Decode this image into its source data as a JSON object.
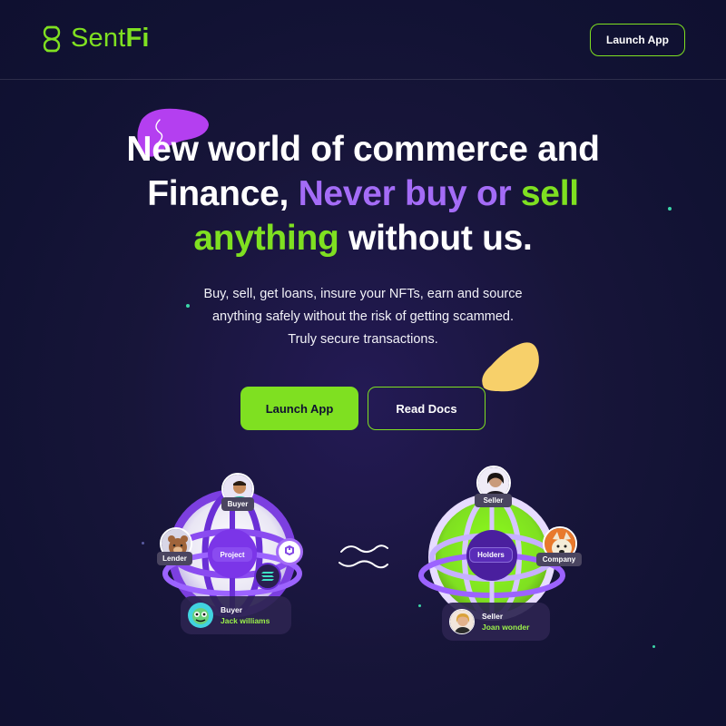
{
  "brand": {
    "name_part1": "Sent",
    "name_part2": "Fi",
    "color": "#7fe021"
  },
  "nav": {
    "launch_label": "Launch App"
  },
  "hero": {
    "line1": "New world of commerce and",
    "line2_white": "Finance, ",
    "line2_purple": "Never buy or ",
    "line2_green": "sell",
    "line3_green": "anything",
    "line3_white": " without us.",
    "sub1": "Buy, sell, get loans, insure your NFTs, earn and source",
    "sub2": "anything safely without the risk of getting scammed.",
    "sub3": "Truly secure transactions.",
    "primary_label": "Launch App",
    "secondary_label": "Read Docs"
  },
  "left_globe": {
    "center_label": "Project",
    "top_tag": "Buyer",
    "left_tag": "Lender",
    "card_title": "Buyer",
    "card_name": "Jack williams",
    "icons": [
      "polygon-icon",
      "solana-icon"
    ]
  },
  "right_globe": {
    "center_label": "Holders",
    "top_tag": "Seller",
    "right_tag": "Company",
    "card_title": "Seller",
    "card_name": "Joan wonder"
  },
  "colors": {
    "accent_green": "#7fe021",
    "accent_purple": "#a46cf7",
    "blob_yellow": "#f7d06a",
    "blob_magenta": "#b43ff0",
    "bg": "#161538"
  }
}
